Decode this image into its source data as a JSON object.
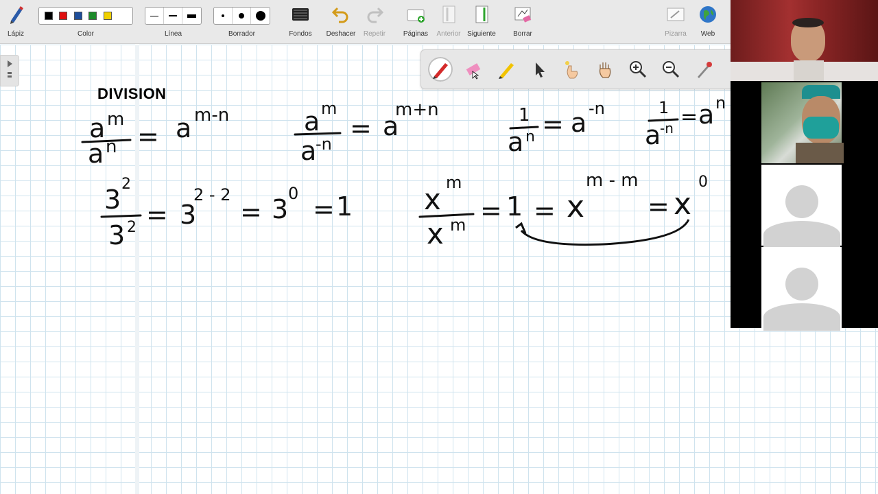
{
  "toolbar": {
    "pencil_label": "Lápiz",
    "color_label": "Color",
    "line_label": "Línea",
    "eraser_label": "Borrador",
    "backgrounds_label": "Fondos",
    "undo_label": "Deshacer",
    "redo_label": "Repetir",
    "pages_label": "Páginas",
    "previous_label": "Anterior",
    "next_label": "Siguiente",
    "clear_label": "Borrar",
    "whiteboard_label": "Pizarra",
    "web_label": "Web",
    "colors": [
      "#000000",
      "#e01010",
      "#1f4e9a",
      "#1d8a2a",
      "#f0d000"
    ]
  },
  "drawbar": {
    "tools": [
      "pen-icon",
      "eraser-icon",
      "highlighter-icon",
      "pointer-icon",
      "laser-hand-icon",
      "pan-hand-icon",
      "zoom-in-icon",
      "zoom-out-icon",
      "eyedropper-icon"
    ]
  },
  "board": {
    "title": "DIVISION",
    "ink": {
      "r1a_num": "a",
      "r1a_num_sup": "m",
      "r1a_den": "a",
      "r1a_den_sup": "n",
      "r1a_eq": "=",
      "r1a_res": "a",
      "r1a_res_sup": "m-n",
      "r1b_num": "a",
      "r1b_num_sup": "m",
      "r1b_den": "a",
      "r1b_den_sup": "-n",
      "r1b_eq": "=",
      "r1b_res": "a",
      "r1b_res_sup": "m+n",
      "r1c_num": "1",
      "r1c_den": "a",
      "r1c_den_sup": "n",
      "r1c_eq": "=",
      "r1c_res": "a",
      "r1c_res_sup": "-n",
      "r1d_num": "1",
      "r1d_den": "a",
      "r1d_den_sup": "-n",
      "r1d_eq": "=",
      "r1d_res": "a",
      "r1d_res_sup": "n",
      "r2a_num": "3",
      "r2a_num_sup": "2",
      "r2a_den": "3",
      "r2a_den_sup": "2",
      "r2a_eq1": "=",
      "r2a_b1": "3",
      "r2a_b1_sup": "2 - 2",
      "r2a_eq2": "=",
      "r2a_b2": "3",
      "r2a_b2_sup": "0",
      "r2a_eq3": "=",
      "r2a_one": "1",
      "r2b_num": "x",
      "r2b_num_sup": "m",
      "r2b_den": "x",
      "r2b_den_sup": "m",
      "r2b_eq1": "=",
      "r2b_one": "1",
      "r2b_eq2": "=",
      "r2b_b1": "x",
      "r2b_b1_sup": "m - m",
      "r2b_eq3": "=",
      "r2b_b2": "x",
      "r2b_b2_sup": "0"
    }
  },
  "video": {
    "participants": [
      "participant-1",
      "participant-2",
      "participant-3",
      "participant-4"
    ]
  }
}
